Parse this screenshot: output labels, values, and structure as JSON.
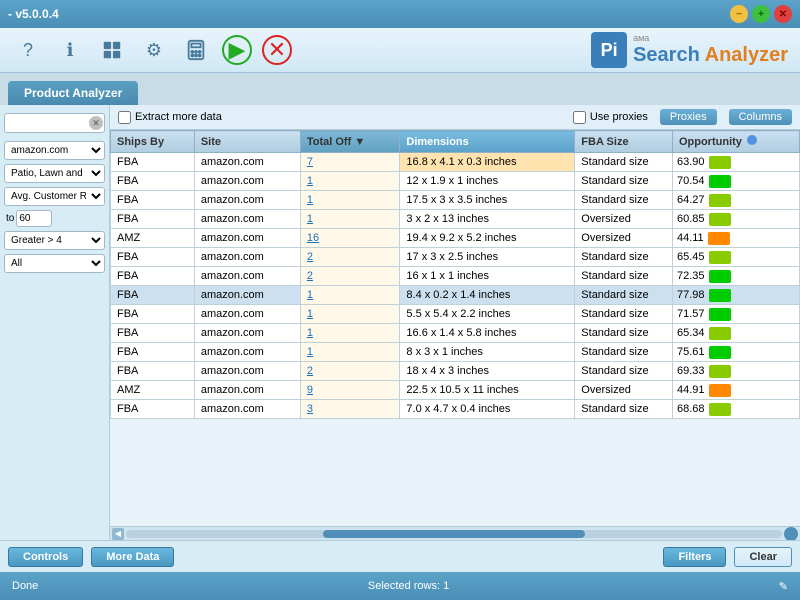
{
  "titlebar": {
    "title": "- v5.0.0.4",
    "min_btn": "−",
    "max_btn": "+",
    "close_btn": "✕"
  },
  "toolbar": {
    "icons": [
      "?",
      "ℹ",
      "?",
      "⚙",
      "▦",
      "▶",
      "✕"
    ],
    "app_prefix": "aма",
    "app_name_search": "Search",
    "app_name_analyzer": "Analyzer",
    "logo_text": "Pi"
  },
  "tabs": [
    {
      "label": "Product Analyzer"
    }
  ],
  "options": {
    "extract_more_data": "Extract more data",
    "use_proxies": "Use proxies",
    "proxies_btn": "Proxies",
    "columns_btn": "Columns"
  },
  "table": {
    "columns": [
      {
        "id": "ships_by",
        "label": "Ships By"
      },
      {
        "id": "site",
        "label": "Site"
      },
      {
        "id": "total_off",
        "label": "Total Off",
        "sorted": true
      },
      {
        "id": "dimensions",
        "label": "Dimensions"
      },
      {
        "id": "fba_size",
        "label": "FBA Size"
      },
      {
        "id": "opportunity",
        "label": "Opportunity"
      }
    ],
    "rows": [
      {
        "ships_by": "FBA",
        "site": "amazon.com",
        "total_off": "7",
        "dimensions": "16.8 x 4.1 x 0.3 inches",
        "fba_size": "Standard size",
        "opportunity": "63.90",
        "opp_color": "green",
        "selected": false,
        "dim_highlight": true
      },
      {
        "ships_by": "FBA",
        "site": "amazon.com",
        "total_off": "1",
        "dimensions": "12 x 1.9 x 1 inches",
        "fba_size": "Standard size",
        "opportunity": "70.54",
        "opp_color": "green",
        "selected": false
      },
      {
        "ships_by": "FBA",
        "site": "amazon.com",
        "total_off": "1",
        "dimensions": "17.5 x 3 x 3.5 inches",
        "fba_size": "Standard size",
        "opportunity": "64.27",
        "opp_color": "green",
        "selected": false
      },
      {
        "ships_by": "FBA",
        "site": "amazon.com",
        "total_off": "1",
        "dimensions": "3 x 2 x 13 inches",
        "fba_size": "Oversized",
        "opportunity": "60.85",
        "opp_color": "green",
        "selected": false
      },
      {
        "ships_by": "AMZ",
        "site": "amazon.com",
        "total_off": "16",
        "dimensions": "19.4 x 9.2 x 5.2 inches",
        "fba_size": "Oversized",
        "opportunity": "44.11",
        "opp_color": "yellow",
        "selected": false
      },
      {
        "ships_by": "FBA",
        "site": "amazon.com",
        "total_off": "2",
        "dimensions": "17 x 3 x 2.5 inches",
        "fba_size": "Standard size",
        "opportunity": "65.45",
        "opp_color": "green",
        "selected": false
      },
      {
        "ships_by": "FBA",
        "site": "amazon.com",
        "total_off": "2",
        "dimensions": "16 x 1 x 1 inches",
        "fba_size": "Standard size",
        "opportunity": "72.35",
        "opp_color": "green",
        "selected": false
      },
      {
        "ships_by": "FBA",
        "site": "amazon.com",
        "total_off": "1",
        "dimensions": "8.4 x 0.2 x 1.4 inches",
        "fba_size": "Standard size",
        "opportunity": "77.98",
        "opp_color": "green",
        "selected": true
      },
      {
        "ships_by": "FBA",
        "site": "amazon.com",
        "total_off": "1",
        "dimensions": "5.5 x 5.4 x 2.2 inches",
        "fba_size": "Standard size",
        "opportunity": "71.57",
        "opp_color": "green",
        "selected": false
      },
      {
        "ships_by": "FBA",
        "site": "amazon.com",
        "total_off": "1",
        "dimensions": "16.6 x 1.4 x 5.8 inches",
        "fba_size": "Standard size",
        "opportunity": "65.34",
        "opp_color": "green",
        "selected": false
      },
      {
        "ships_by": "FBA",
        "site": "amazon.com",
        "total_off": "1",
        "dimensions": "8 x 3 x 1 inches",
        "fba_size": "Standard size",
        "opportunity": "75.61",
        "opp_color": "green",
        "selected": false
      },
      {
        "ships_by": "FBA",
        "site": "amazon.com",
        "total_off": "2",
        "dimensions": "18 x 4 x 3 inches",
        "fba_size": "Standard size",
        "opportunity": "69.33",
        "opp_color": "green",
        "selected": false
      },
      {
        "ships_by": "AMZ",
        "site": "amazon.com",
        "total_off": "9",
        "dimensions": "22.5 x 10.5 x 11 inches",
        "fba_size": "Oversized",
        "opportunity": "44.91",
        "opp_color": "yellow",
        "selected": false
      },
      {
        "ships_by": "FBA",
        "site": "amazon.com",
        "total_off": "3",
        "dimensions": "7.0 x 4.7 x 0.4 inches",
        "fba_size": "Standard size",
        "opportunity": "68.68",
        "opp_color": "green",
        "selected": false
      }
    ]
  },
  "sidebar": {
    "search_placeholder": "",
    "dropdowns": [
      {
        "label": "amazon.com",
        "id": "site-select"
      },
      {
        "label": "Patio, Lawn and ...",
        "id": "category-select"
      },
      {
        "label": "Avg. Customer R...",
        "id": "rating-select"
      },
      {
        "label": "Greater > 4",
        "id": "filter-select"
      },
      {
        "label": "All",
        "id": "type-select"
      }
    ],
    "range": {
      "label": "to",
      "max": "60"
    }
  },
  "bottom": {
    "controls_btn": "Controls",
    "more_data_btn": "More Data",
    "filters_btn": "Filters",
    "clear_btn": "Clear"
  },
  "statusbar": {
    "done_label": "Done",
    "selected_rows": "Selected rows: 1"
  }
}
